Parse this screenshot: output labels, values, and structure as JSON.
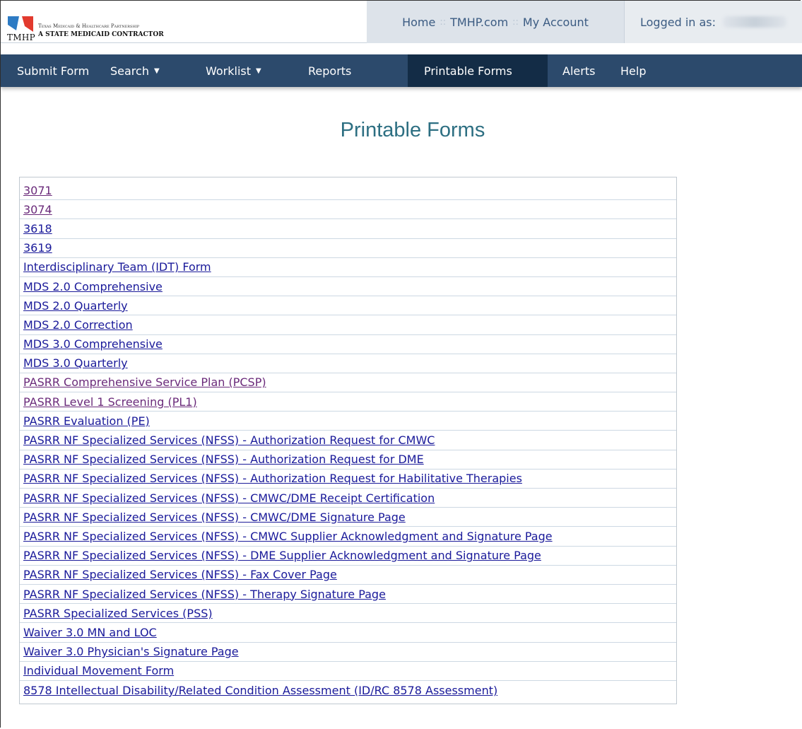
{
  "header": {
    "logo_abbr": "TMHP",
    "logo_line1": "Texas Medicaid & Healthcare Partnership",
    "logo_line2": "A STATE MEDICAID CONTRACTOR",
    "links": [
      "Home",
      "TMHP.com",
      "My Account"
    ],
    "separator": "::",
    "logged_in_label": "Logged in as:"
  },
  "nav": {
    "items": [
      {
        "label": "Submit Form",
        "dropdown": false
      },
      {
        "label": "Search",
        "dropdown": true
      },
      {
        "label": "Worklist",
        "dropdown": true
      },
      {
        "label": "Reports",
        "dropdown": false
      },
      {
        "label": "Printable Forms",
        "dropdown": false,
        "active": true
      },
      {
        "label": "Alerts",
        "dropdown": false
      },
      {
        "label": "Help",
        "dropdown": false
      }
    ],
    "caret": "▼"
  },
  "page_title": "Printable Forms",
  "colors": {
    "nav_bg": "#2c4a6c",
    "nav_active_bg": "#132c46",
    "title": "#2d6f82",
    "link": "#1a1a9a",
    "link_visited": "#6a2a7a"
  },
  "forms": [
    {
      "label": "3071",
      "visited": true
    },
    {
      "label": "3074",
      "visited": true
    },
    {
      "label": "3618",
      "visited": false
    },
    {
      "label": "3619",
      "visited": false
    },
    {
      "label": "Interdisciplinary Team (IDT) Form",
      "visited": false
    },
    {
      "label": "MDS 2.0 Comprehensive",
      "visited": false
    },
    {
      "label": "MDS 2.0 Quarterly",
      "visited": false
    },
    {
      "label": "MDS 2.0 Correction",
      "visited": false
    },
    {
      "label": "MDS 3.0 Comprehensive",
      "visited": false
    },
    {
      "label": "MDS 3.0 Quarterly",
      "visited": false
    },
    {
      "label": "PASRR Comprehensive Service Plan (PCSP)",
      "visited": true
    },
    {
      "label": "PASRR Level 1 Screening (PL1)",
      "visited": true
    },
    {
      "label": "PASRR Evaluation (PE)",
      "visited": false
    },
    {
      "label": "PASRR NF Specialized Services (NFSS) - Authorization Request for CMWC",
      "visited": false
    },
    {
      "label": "PASRR NF Specialized Services (NFSS) - Authorization Request for DME",
      "visited": false
    },
    {
      "label": "PASRR NF Specialized Services (NFSS) - Authorization Request for Habilitative Therapies",
      "visited": false
    },
    {
      "label": "PASRR NF Specialized Services (NFSS) - CMWC/DME Receipt Certification",
      "visited": false
    },
    {
      "label": "PASRR NF Specialized Services (NFSS) - CMWC/DME Signature Page",
      "visited": false
    },
    {
      "label": "PASRR NF Specialized Services (NFSS) - CMWC Supplier Acknowledgment and Signature Page",
      "visited": false
    },
    {
      "label": "PASRR NF Specialized Services (NFSS) - DME Supplier Acknowledgment and Signature Page",
      "visited": false
    },
    {
      "label": "PASRR NF Specialized Services (NFSS) - Fax Cover Page",
      "visited": false
    },
    {
      "label": "PASRR NF Specialized Services (NFSS) - Therapy Signature Page",
      "visited": false
    },
    {
      "label": "PASRR Specialized Services (PSS)",
      "visited": false
    },
    {
      "label": "Waiver 3.0 MN and LOC",
      "visited": false
    },
    {
      "label": "Waiver 3.0 Physician's Signature Page",
      "visited": false
    },
    {
      "label": "Individual Movement Form",
      "visited": false
    },
    {
      "label": "8578 Intellectual Disability/Related Condition Assessment (ID/RC 8578 Assessment)",
      "visited": false
    }
  ]
}
